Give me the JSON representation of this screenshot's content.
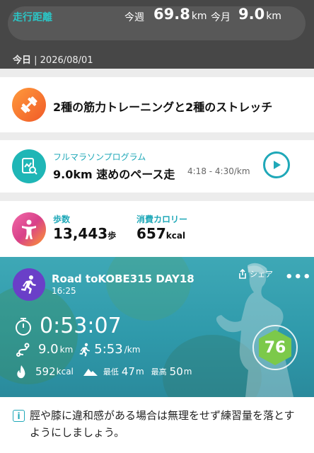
{
  "summary": {
    "distance_label": "走行距離",
    "week_label": "今週",
    "week_value": "69.8",
    "week_unit": "km",
    "month_label": "今月",
    "month_value": "9.0",
    "month_unit": "km"
  },
  "date": {
    "prefix": "今日",
    "value": " | 2026/08/01"
  },
  "workout": {
    "title": "2種の筋力トレーニングと2種のストレッチ",
    "icon": "dumbbell-icon"
  },
  "program": {
    "category": "フルマラソンプログラム",
    "title": "9.0km 速めのペース走",
    "pace": "4:18 - 4:30/km",
    "icon": "document-chart-icon"
  },
  "daily": {
    "steps_label": "歩数",
    "steps_value": "13,443",
    "steps_unit": "歩",
    "kcal_label": "消費カロリー",
    "kcal_value": "657",
    "kcal_unit": "kcal"
  },
  "activity": {
    "title": "Road toKOBE315 DAY18",
    "time": "16:25",
    "share_label": "シェア",
    "more_label": "•••",
    "duration": "0:53:07",
    "distance": "9.0",
    "distance_unit": "km",
    "pace": "5:53",
    "pace_unit": "/km",
    "calories": "592",
    "calories_unit": "kcal",
    "elev_min_label": "最低",
    "elev_min": "47",
    "elev_min_unit": "m",
    "elev_max_label": "最高",
    "elev_max": "50",
    "elev_max_unit": "m",
    "score": "76"
  },
  "notice": {
    "text": "脛や膝に違和感がある場合は無理をせず練習量を落とすようにしましょう。"
  },
  "colors": {
    "accent": "#1fa8b8",
    "header": "#474747",
    "score": "#7cc94a",
    "activity_icon": "#6a3fc8"
  }
}
